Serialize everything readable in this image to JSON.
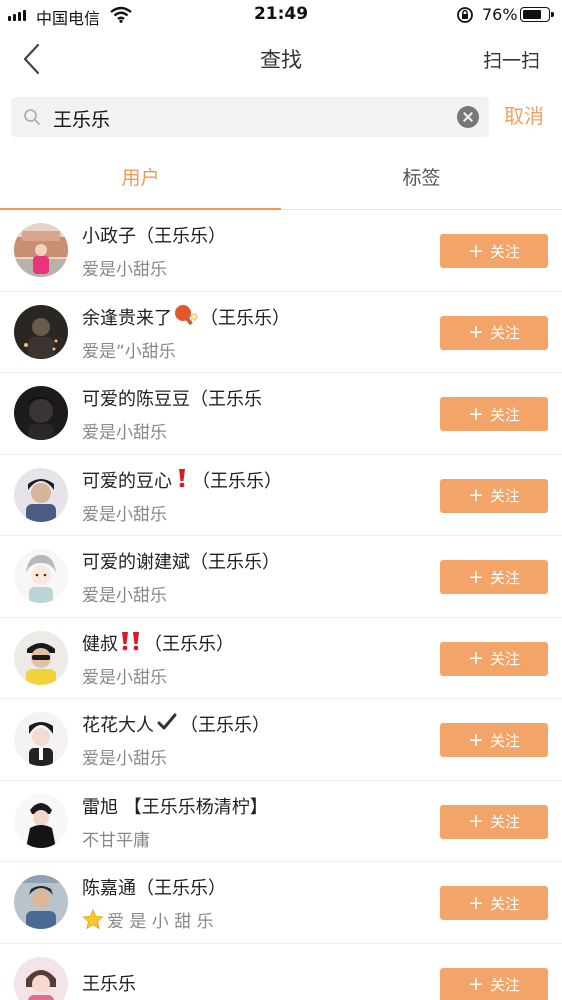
{
  "status_bar": {
    "carrier": "中国电信",
    "time": "21:49",
    "battery_percent": "76%",
    "battery_level": 0.76
  },
  "nav": {
    "title": "查找",
    "scan_label": "扫一扫",
    "back_icon": "chevron-left-icon"
  },
  "search": {
    "value": "王乐乐",
    "cancel_label": "取消",
    "search_icon": "search-icon",
    "clear_icon": "clear-icon"
  },
  "tabs": [
    {
      "label": "用户",
      "active": true
    },
    {
      "label": "标签",
      "active": false
    }
  ],
  "follow_label": "关注",
  "colors": {
    "accent": "#f3a569",
    "accent_text": "#ef9a58"
  },
  "users": [
    {
      "name": "小政子（王乐乐）",
      "bio": "爱是小甜乐"
    },
    {
      "name_before": "余逢贵来了",
      "name_after": "（王乐乐）",
      "emoji": "ping-pong-icon",
      "bio": "爱是“小甜乐"
    },
    {
      "name": "可爱的陈豆豆（王乐乐",
      "bio": "爱是小甜乐"
    },
    {
      "name_before": "可爱的豆心",
      "name_after": "（王乐乐）",
      "emoji": "exclamation-icon",
      "bio": "爱是小甜乐"
    },
    {
      "name": "可爱的谢建斌（王乐乐）",
      "bio": "爱是小甜乐"
    },
    {
      "name_before": "健叔",
      "name_after": "（王乐乐）",
      "emoji": "double-exclamation-icon",
      "bio": "爱是小甜乐"
    },
    {
      "name_before": "花花大人",
      "name_after": "（王乐乐）",
      "emoji": "check-mark-icon",
      "bio": "爱是小甜乐"
    },
    {
      "name": "雷旭 【王乐乐杨清柠】",
      "bio": "不甘平庸"
    },
    {
      "name": "陈嘉通（王乐乐）",
      "bio": "爱 是 小 甜 乐",
      "bio_icon": "star-icon"
    },
    {
      "name": "王乐乐",
      "bio": ""
    }
  ]
}
